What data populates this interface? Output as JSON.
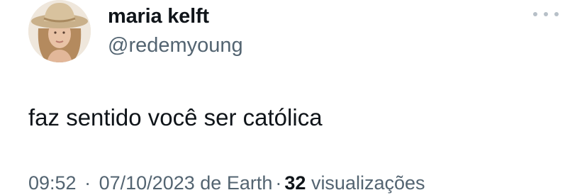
{
  "tweet": {
    "author": {
      "display_name": "maria kelft",
      "handle": "@redemyoung",
      "avatar": "profile-photo-cowboy-hat"
    },
    "more_icon": "ellipsis-icon",
    "text": "faz sentido você ser católica",
    "meta": {
      "time": "09:52",
      "separator": "·",
      "date": "07/10/2023",
      "source_prefix": "de",
      "source": "Earth",
      "views_count": "32",
      "views_label": "visualizações"
    }
  },
  "colors": {
    "primary_text": "#0f1419",
    "secondary_text": "#536471",
    "background": "#ffffff"
  }
}
